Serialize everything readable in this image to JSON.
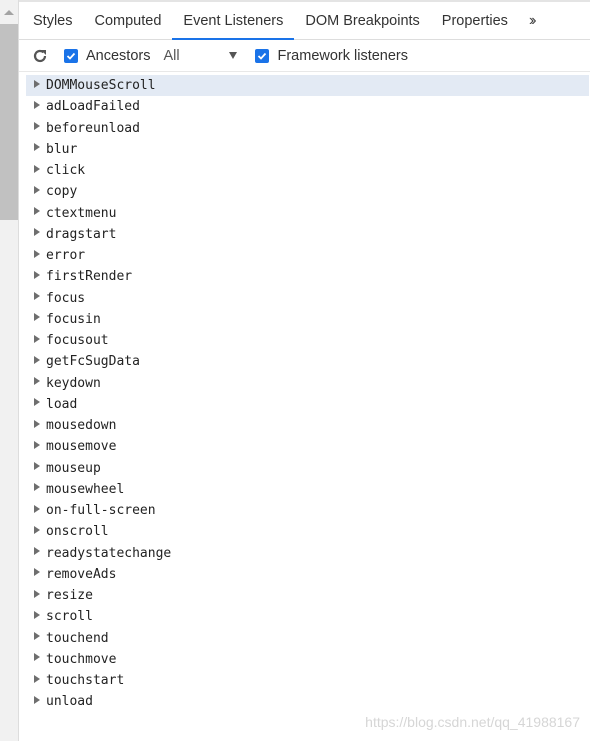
{
  "tabs": [
    {
      "label": "Styles",
      "active": false
    },
    {
      "label": "Computed",
      "active": false
    },
    {
      "label": "Event Listeners",
      "active": true
    },
    {
      "label": "DOM Breakpoints",
      "active": false
    },
    {
      "label": "Properties",
      "active": false
    }
  ],
  "more_tabs_icon": "chevron-double-right",
  "toolbar": {
    "refresh_icon": "refresh",
    "ancestors": {
      "label": "Ancestors",
      "checked": true
    },
    "filter_select": {
      "value": "All"
    },
    "framework": {
      "label": "Framework listeners",
      "checked": true
    }
  },
  "accent_color": "#1a73e8",
  "listeners": [
    "DOMMouseScroll",
    "adLoadFailed",
    "beforeunload",
    "blur",
    "click",
    "copy",
    "ctextmenu",
    "dragstart",
    "error",
    "firstRender",
    "focus",
    "focusin",
    "focusout",
    "getFcSugData",
    "keydown",
    "load",
    "mousedown",
    "mousemove",
    "mouseup",
    "mousewheel",
    "on-full-screen",
    "onscroll",
    "readystatechange",
    "removeAds",
    "resize",
    "scroll",
    "touchend",
    "touchmove",
    "touchstart",
    "unload"
  ],
  "selected_listener": "DOMMouseScroll",
  "watermark": "https://blog.csdn.net/qq_41988167"
}
